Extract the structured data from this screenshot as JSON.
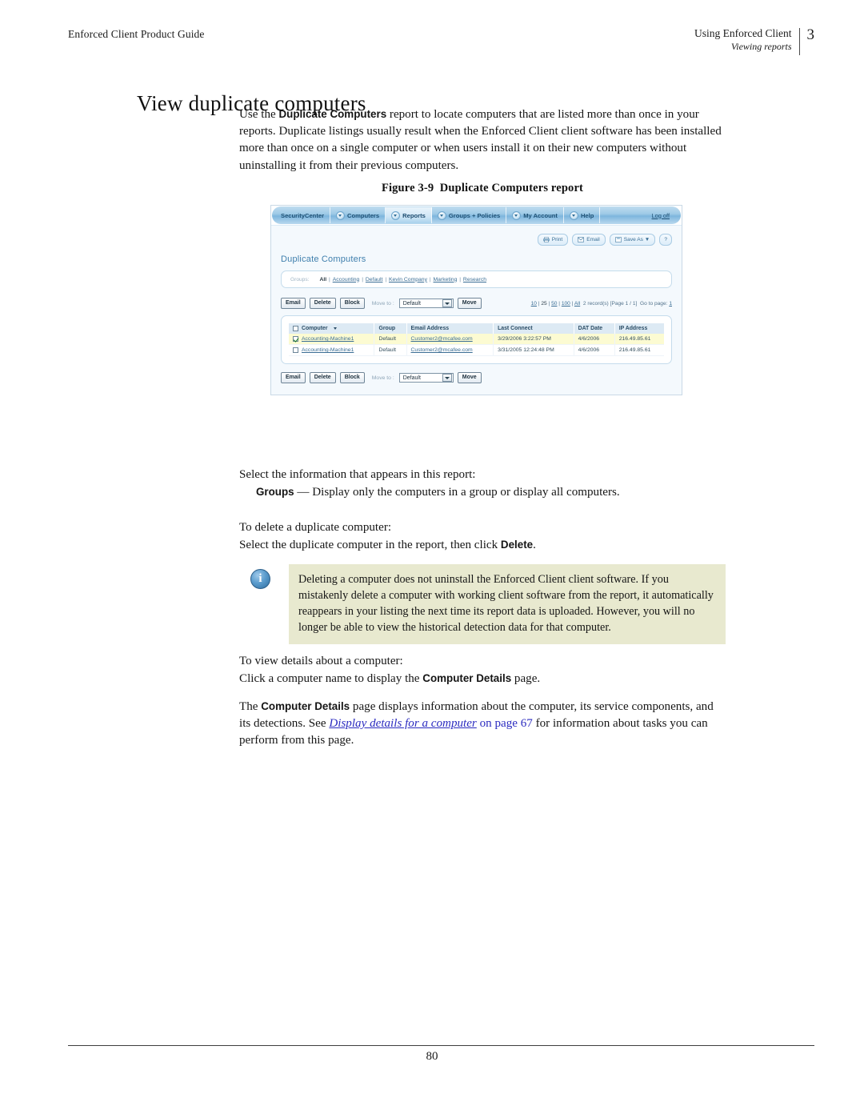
{
  "header": {
    "left": "Enforced Client Product Guide",
    "chapter": "Using Enforced Client",
    "section": "Viewing reports",
    "page_number": "3"
  },
  "title": "View duplicate computers",
  "paragraphs": {
    "intro_1": "Use the ",
    "intro_bold": "Duplicate Computers",
    "intro_2": " report to locate computers that are listed more than once in your reports. Duplicate listings usually result when the Enforced Client client software has been installed more than once on a single computer or when users install it on their new computers without uninstalling it from their previous computers.",
    "select_info": "Select the information that appears in this report:",
    "groups_term": "Groups",
    "groups_desc": " — Display only the computers in a group or display all computers.",
    "to_delete": "To delete a duplicate computer:",
    "delete_1": "Select the duplicate computer in the report, then click ",
    "delete_bold": "Delete",
    "delete_2": ".",
    "to_view": "To view details about a computer:",
    "click_1": "Click a computer name to display the ",
    "click_bold": "Computer Details",
    "click_2": " page.",
    "final_1": "The ",
    "final_bold": "Computer Details",
    "final_2": " page displays information about the computer, its service components, and its detections. See ",
    "final_xref": "Display details for a computer",
    "final_xref_page": " on page 67",
    "final_3": " for information about tasks you can perform from this page."
  },
  "note": {
    "icon_glyph": "i",
    "text": "Deleting a computer does not uninstall the Enforced Client client software. If you mistakenly delete a computer with working client software from the report, it automatically reappears in your listing the next time its report data is uploaded. However, you will no longer be able to view the historical detection data for that computer."
  },
  "figure": {
    "caption_label": "Figure 3-9",
    "caption_text": "Duplicate Computers report",
    "nav": {
      "items": [
        {
          "label": "SecurityCenter",
          "has_caret": false,
          "active": false
        },
        {
          "label": "Computers",
          "has_caret": true,
          "active": false
        },
        {
          "label": "Reports",
          "has_caret": true,
          "active": true
        },
        {
          "label": "Groups + Policies",
          "has_caret": true,
          "active": false
        },
        {
          "label": "My Account",
          "has_caret": true,
          "active": false
        },
        {
          "label": "Help",
          "has_caret": true,
          "active": false
        }
      ],
      "logoff": "Log off"
    },
    "toolbar": [
      {
        "label": "Print",
        "icon": "printer-icon"
      },
      {
        "label": "Email",
        "icon": "envelope-icon"
      },
      {
        "label": "Save As ▼",
        "icon": "disk-icon"
      },
      {
        "label": "?",
        "icon": "help-icon"
      }
    ],
    "report_title": "Duplicate Computers",
    "groups_filter": {
      "label": "Groups:",
      "selected": "All",
      "links": [
        "Accounting",
        "Default",
        "Kevin Company",
        "Marketing",
        "Research"
      ]
    },
    "actions": {
      "email": "Email",
      "delete": "Delete",
      "block": "Block",
      "move_to_label": "Move to :",
      "move_to_value": "Default",
      "move": "Move"
    },
    "pager": {
      "sizes": [
        "10",
        "25",
        "50",
        "100",
        "All"
      ],
      "current_size": "25",
      "records": "2 record(s)",
      "page_info": "[Page 1 / 1]",
      "goto_label": "Go to page:",
      "goto_value": "1"
    },
    "table": {
      "columns": [
        "Computer",
        "Group",
        "Email Address",
        "Last Connect",
        "DAT Date",
        "IP Address"
      ],
      "sort_column": "Computer",
      "rows": [
        {
          "checked": true,
          "highlight": true,
          "computer": "Accounting-Machine1",
          "group": "Default",
          "email": "Customer2@mcafee.com",
          "last_connect": "3/29/2006 3:22:57 PM",
          "dat_date": "4/6/2006",
          "ip": "216.49.85.61"
        },
        {
          "checked": false,
          "highlight": false,
          "computer": "Accounting-Machine1",
          "group": "Default",
          "email": "Customer2@mcafee.com",
          "last_connect": "3/31/2005 12:24:48 PM",
          "dat_date": "4/6/2006",
          "ip": "216.49.85.61"
        }
      ]
    }
  },
  "footer": {
    "page": "80"
  }
}
